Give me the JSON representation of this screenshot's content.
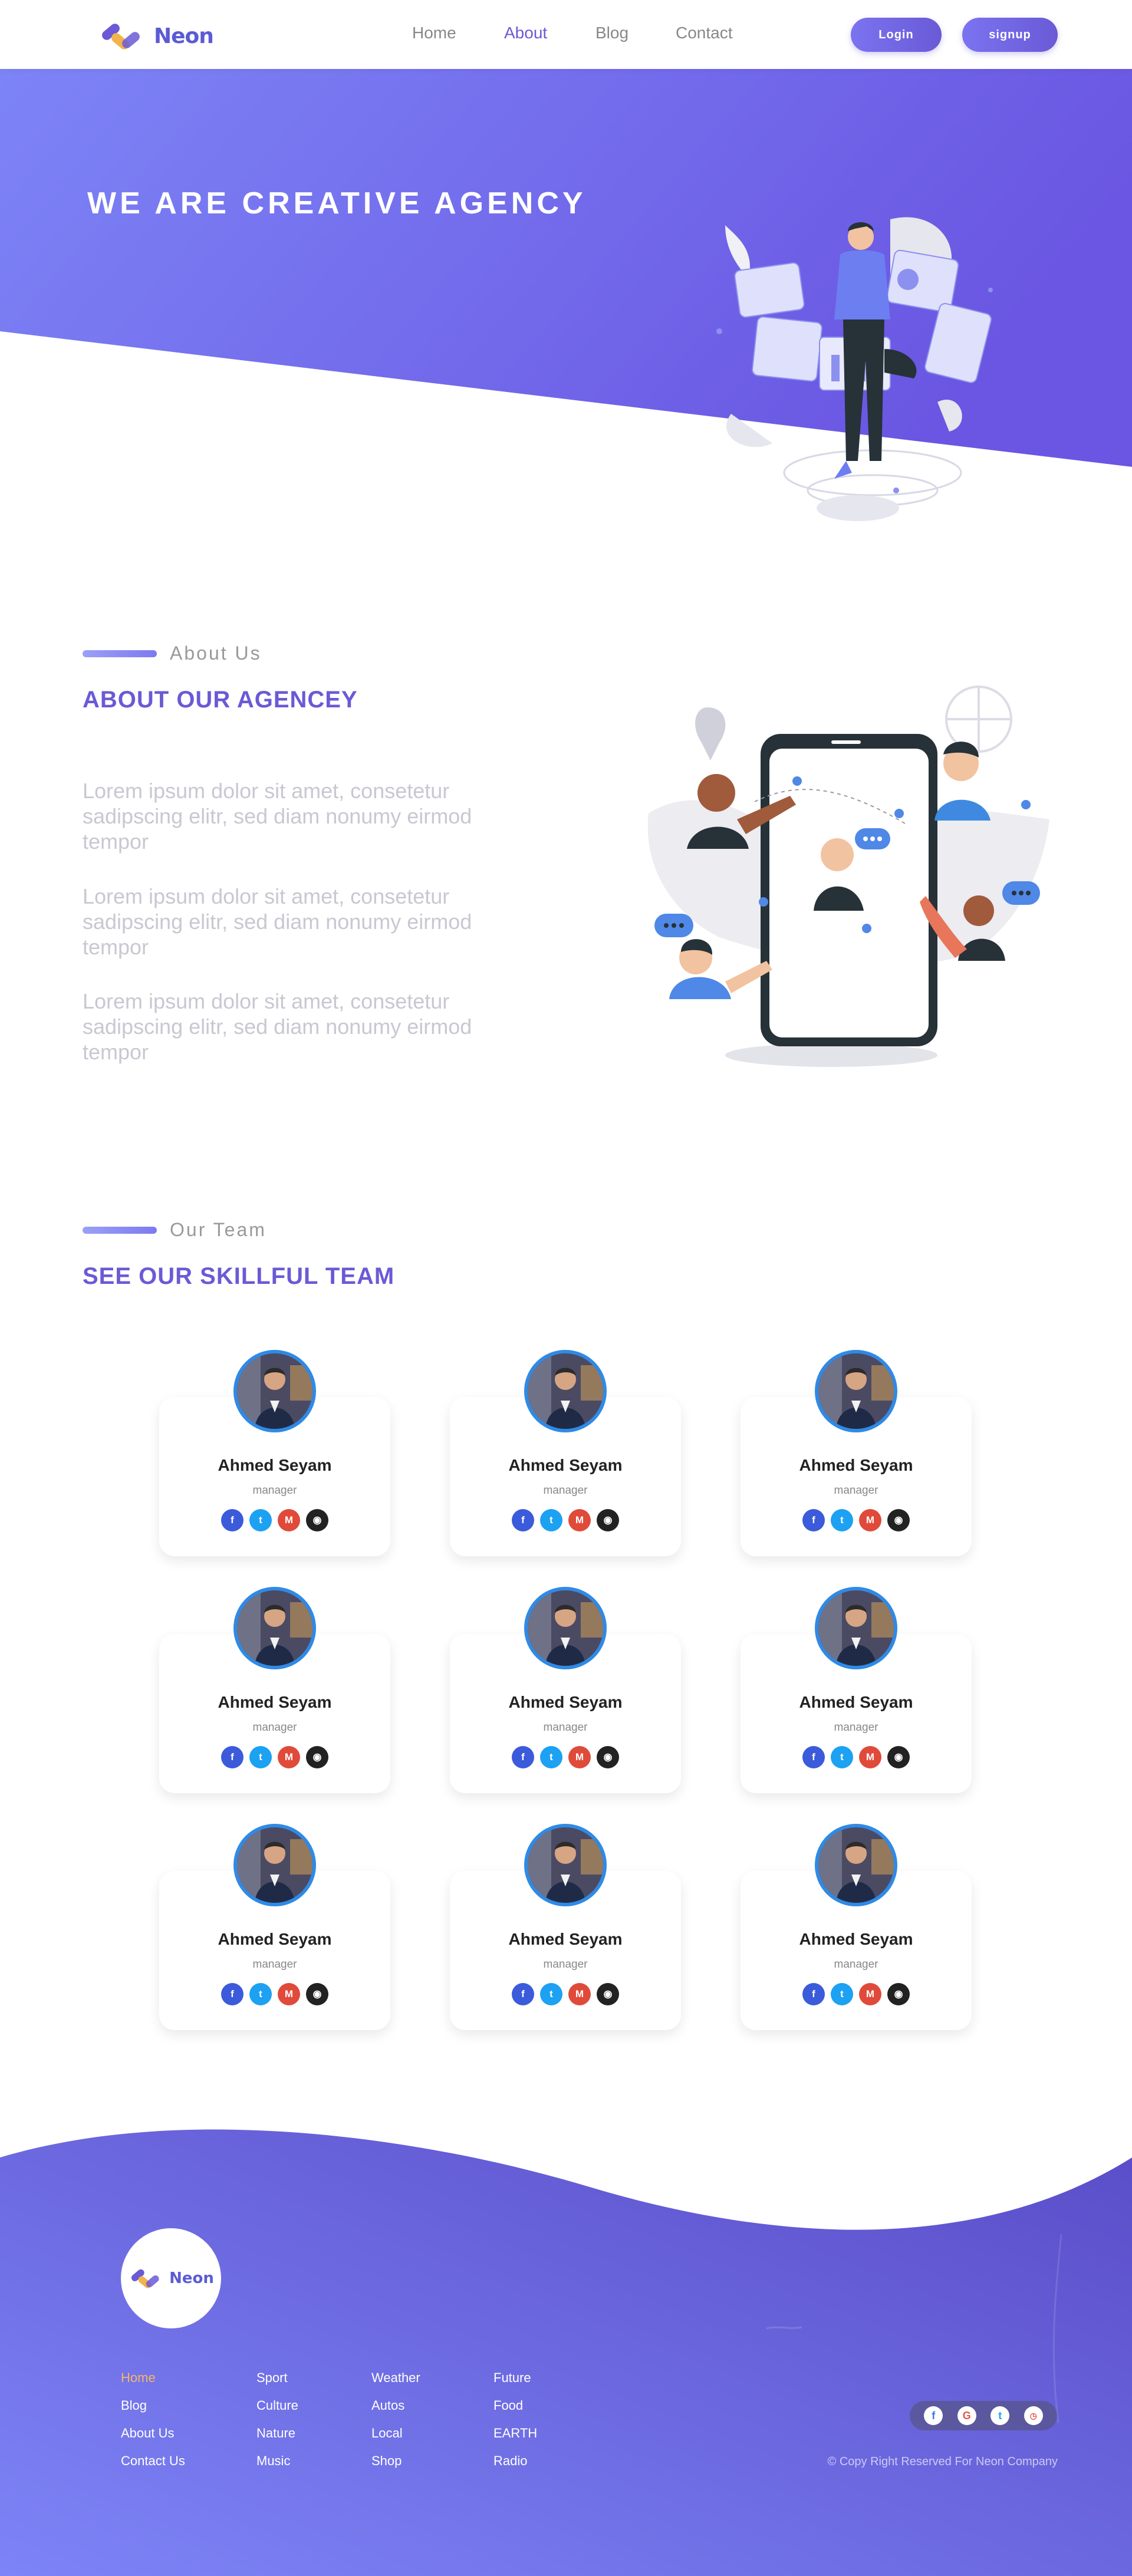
{
  "brand": {
    "name": "Neon"
  },
  "nav": {
    "links": [
      {
        "label": "Home",
        "active": false
      },
      {
        "label": "About",
        "active": true
      },
      {
        "label": "Blog",
        "active": false
      },
      {
        "label": "Contact",
        "active": false
      }
    ],
    "login_label": "Login",
    "signup_label": "signup"
  },
  "hero": {
    "title": "WE ARE CREATIVE AGENCY"
  },
  "about": {
    "kicker": "About Us",
    "title": "ABOUT OUR AGENCEY",
    "paragraphs": [
      "Lorem ipsum dolor sit amet, consetetur sadipscing elitr, sed diam nonumy eirmod tempor",
      "Lorem ipsum dolor sit amet, consetetur sadipscing elitr, sed diam nonumy eirmod tempor",
      "Lorem ipsum dolor sit amet, consetetur sadipscing elitr, sed diam nonumy eirmod tempor"
    ]
  },
  "team": {
    "kicker": "Our Team",
    "title": "SEE OUR SKILLFUL TEAM",
    "members": [
      {
        "name": "Ahmed Seyam",
        "role": "manager"
      },
      {
        "name": "Ahmed Seyam",
        "role": "manager"
      },
      {
        "name": "Ahmed Seyam",
        "role": "manager"
      },
      {
        "name": "Ahmed Seyam",
        "role": "manager"
      },
      {
        "name": "Ahmed Seyam",
        "role": "manager"
      },
      {
        "name": "Ahmed Seyam",
        "role": "manager"
      },
      {
        "name": "Ahmed Seyam",
        "role": "manager"
      },
      {
        "name": "Ahmed Seyam",
        "role": "manager"
      },
      {
        "name": "Ahmed Seyam",
        "role": "manager"
      }
    ],
    "social_icons": [
      "facebook-icon",
      "twitter-icon",
      "gmail-icon",
      "github-icon"
    ]
  },
  "footer": {
    "columns": [
      [
        "Home",
        "Blog",
        "About Us",
        "Contact Us"
      ],
      [
        "Sport",
        "Culture",
        "Nature",
        "Music"
      ],
      [
        "Weather",
        "Autos",
        "Local",
        "Shop"
      ],
      [
        "Future",
        "Food",
        "EARTH",
        "Radio"
      ]
    ],
    "social_icons": [
      "facebook-icon",
      "google-icon",
      "twitter-icon",
      "clock-icon"
    ],
    "copyright": "© Copy Right Reserved For Neon Company"
  },
  "colors": {
    "accent": "#6a5ad6",
    "hero_start": "#7d84f6",
    "hero_end": "#6a56e2",
    "footer_highlight": "#f3b56a"
  }
}
